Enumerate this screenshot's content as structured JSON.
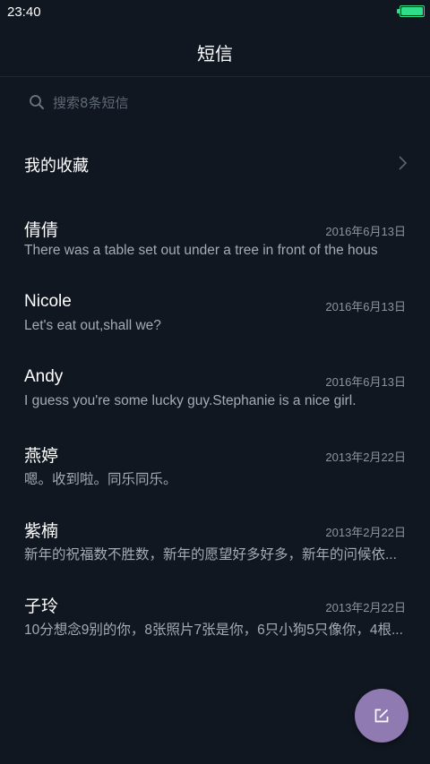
{
  "status_bar": {
    "time": "23:40",
    "battery_level": 1.0,
    "battery_color": "#2fdc8a"
  },
  "header": {
    "title": "短信"
  },
  "search": {
    "placeholder": "搜索8条短信",
    "icon": "search-icon"
  },
  "favorites": {
    "label": "我的收藏",
    "icon": "chevron-right-icon"
  },
  "messages": [
    {
      "name": "倩倩",
      "date": "2016年6月13日",
      "preview": "There was a table set out under a tree in front of the hous"
    },
    {
      "name": "Nicole",
      "date": "2016年6月13日",
      "preview": "Let's eat out,shall we?"
    },
    {
      "name": "Andy",
      "date": "2016年6月13日",
      "preview": "I guess you're some lucky guy.Stephanie is a nice girl."
    },
    {
      "name": "燕婷",
      "date": "2013年2月22日",
      "preview": "嗯。收到啦。同乐同乐。"
    },
    {
      "name": "紫楠",
      "date": "2013年2月22日",
      "preview": "新年的祝福数不胜数，新年的愿望好多好多，新年的问候依..."
    },
    {
      "name": "子玲",
      "date": "2013年2月22日",
      "preview": "10分想念9别的你，8张照片7张是你，6只小狗5只像你，4根..."
    }
  ],
  "compose": {
    "icon": "compose-icon",
    "color": "#8f7ab1"
  },
  "colors": {
    "background": "#101720",
    "accent": "#8f7ab1"
  }
}
